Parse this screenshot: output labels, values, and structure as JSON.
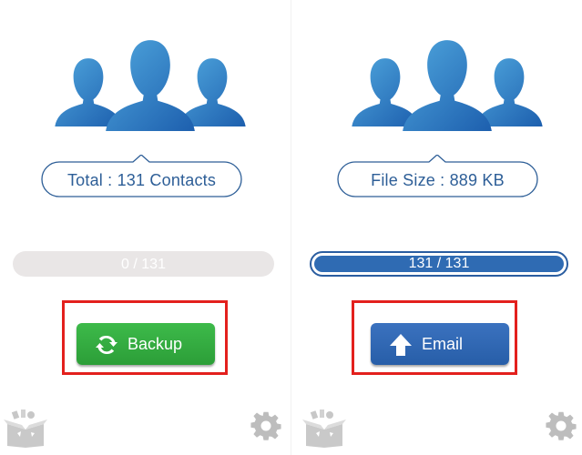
{
  "colors": {
    "accent_blue": "#2f6bb3",
    "contacts_icon_blue": "#3a8fd1",
    "backup_green": "#2fa83c",
    "highlight_red": "#e3201d",
    "track_gray": "#e9e6e6",
    "bubble_text": "#2d5e97"
  },
  "left_panel": {
    "info_label": "Total : 131 Contacts",
    "progress": {
      "text": "0 / 131",
      "value": 0,
      "total": 131
    },
    "action_button": {
      "label": "Backup",
      "icon": "sync-icon"
    },
    "footer_icons": [
      "box-icon",
      "gear-icon"
    ]
  },
  "right_panel": {
    "info_label": "File Size : 889 KB",
    "progress": {
      "text": "131 / 131",
      "value": 131,
      "total": 131
    },
    "action_button": {
      "label": "Email",
      "icon": "upload-arrow-icon"
    },
    "footer_icons": [
      "box-icon",
      "gear-icon"
    ]
  }
}
